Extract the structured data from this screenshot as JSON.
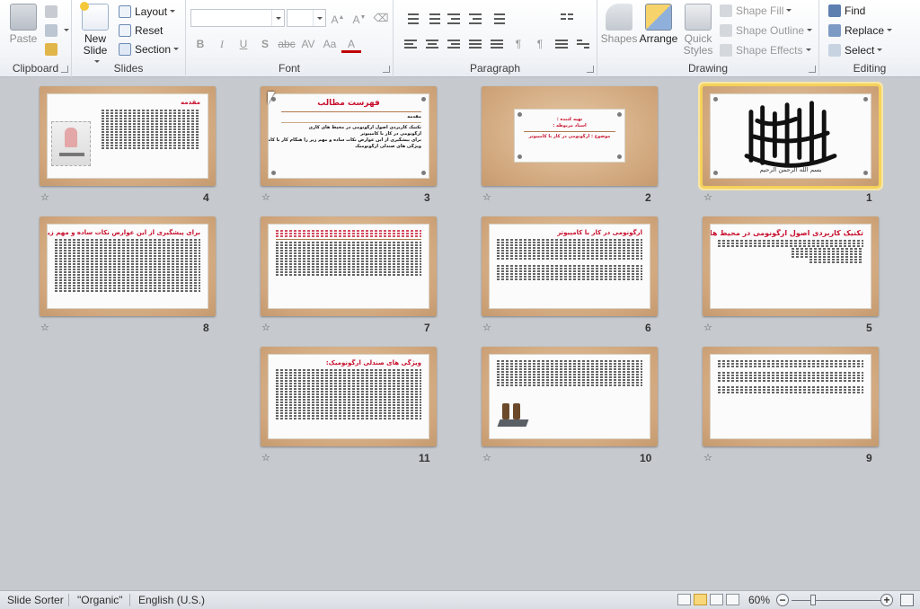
{
  "ribbon": {
    "clipboard": {
      "label": "Clipboard",
      "paste": "Paste"
    },
    "slides": {
      "label": "Slides",
      "new_slide": "New\nSlide",
      "layout": "Layout",
      "reset": "Reset",
      "section": "Section"
    },
    "font": {
      "label": "Font",
      "font_name": "",
      "font_size": ""
    },
    "paragraph": {
      "label": "Paragraph"
    },
    "drawing": {
      "label": "Drawing",
      "shapes": "Shapes",
      "arrange": "Arrange",
      "quick_styles": "Quick\nStyles",
      "shape_fill": "Shape Fill",
      "shape_outline": "Shape Outline",
      "shape_effects": "Shape Effects"
    },
    "editing": {
      "label": "Editing",
      "find": "Find",
      "replace": "Replace",
      "select": "Select"
    }
  },
  "slides": [
    {
      "number": "1",
      "kind": "calligraphy",
      "selected": true,
      "calligraphy": "بسم الله الرحمن الرحیم"
    },
    {
      "number": "2",
      "kind": "title",
      "lines": [
        "تهیه کننده :",
        "استاد مربوطه :",
        "موضوع : ارگونومی در کار با کامپیوتر"
      ]
    },
    {
      "number": "3",
      "kind": "toc",
      "title": "فهرست مطالب",
      "lines": [
        "مقدمه",
        "تکنیک کاربردی اصول ارگونومی در محیط های کاری",
        "ارگونومی در کار با کامپیوتر",
        "برای پیشگیری از این عوارض نکات ساده و مهم زیر را هنگام کار با کامپیوتر رعایت کنید",
        "ویژگی های صندلی ارگونومیک"
      ]
    },
    {
      "number": "4",
      "kind": "intro",
      "title": "مقدمه"
    },
    {
      "number": "5",
      "kind": "text",
      "title": "تکنیک کاربردی اصول ارگونومی در محیط های کاری"
    },
    {
      "number": "6",
      "kind": "text",
      "title": "ارگونومی در کار با کامپیوتر"
    },
    {
      "number": "7",
      "kind": "text",
      "title": ""
    },
    {
      "number": "8",
      "kind": "text",
      "title": "برای پیشگیری از این عوارض نکات ساده و مهم زیر را هنگام کار با کامپیوتر رعایت کنید:"
    },
    {
      "number": "9",
      "kind": "text",
      "title": ""
    },
    {
      "number": "10",
      "kind": "text-image",
      "title": ""
    },
    {
      "number": "11",
      "kind": "text",
      "title": "ویژگی های صندلی ارگونومیک:"
    }
  ],
  "status": {
    "view": "Slide Sorter",
    "theme": "\"Organic\"",
    "language": "English (U.S.)",
    "zoom": "60%",
    "zoom_minus": "−",
    "zoom_plus": "+"
  },
  "colors": {
    "accent": "#c8102e",
    "selection": "#f5d25a",
    "background": "#c6cace"
  }
}
